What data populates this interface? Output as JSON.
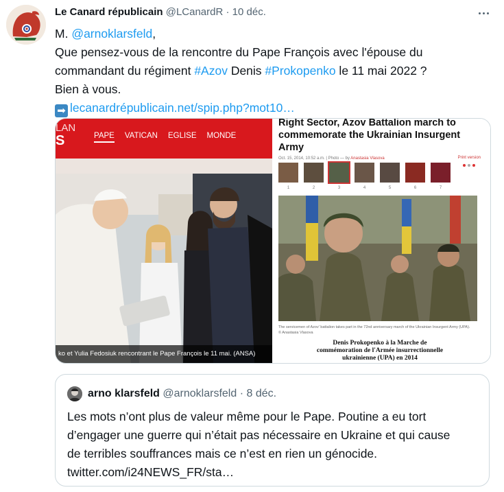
{
  "tweet": {
    "author_name": "Le Canard républicain",
    "handle": "@LCanardR",
    "separator": "·",
    "date": "10 déc.",
    "lines": {
      "l1_prefix": "M. ",
      "l1_mention": "@arnoklarsfeld",
      "l1_suffix": ",",
      "l2": "Que pensez-vous de la rencontre du Pape François avec l'épouse du",
      "l3_a": "commandant du régiment ",
      "l3_tag1": "#Azov",
      "l3_b": " Denis ",
      "l3_tag2": "#Prokopenko",
      "l3_c": " le 11 mai 2022 ?",
      "l4": "Bien à vous.",
      "link": "lecanardrépublicain.net/spip.php?mot10…"
    },
    "arrow_icon": "➡"
  },
  "media": {
    "left": {
      "logo_line1": "LAN",
      "logo_line2": "S",
      "nav": [
        "PAPE",
        "VATICAN",
        "EGLISE",
        "MONDE"
      ],
      "caption": "ko et Yulia Fedosiuk rencontrant le Pape François le 11 mai.  (ANSA)"
    },
    "right": {
      "title": "Right Sector, Azov Battalion march to commemorate the Ukrainian Insurgent Army",
      "meta_text": "Oct. 15, 2014, 10:52 a.m. | Photo — by ",
      "meta_author": "Anastasia Vlasova",
      "print": "Print version",
      "thumb_numbers": [
        "1",
        "2",
        "3",
        "4",
        "5",
        "6",
        "7"
      ],
      "photo_credit": "The servicemen of Azov' battalion takes part in the 72nd anniversary march of the Ukrainian Insurgent Army (UPA).\n© Anastasia Vlasova",
      "fr_caption_1": "Denis Prokopenko à la Marche de",
      "fr_caption_2": "commémoration de l'Armée insurrectionnelle",
      "fr_caption_3": "ukrainienne (UPA) en 2014"
    }
  },
  "quoted": {
    "author_name": "arno klarsfeld",
    "handle": "@arnoklarsfeld",
    "separator": "·",
    "date": "8 déc.",
    "line1": "Les mots n’ont plus de valeur même pour le Pape. Poutine a eu tort",
    "line2": "d’engager une guerre qui n’était pas nécessaire en Ukraine et qui cause",
    "line3": "de terribles souffrances mais ce n’est en rien un génocide.",
    "line4": "twitter.com/i24NEWS_FR/sta…"
  },
  "colors": {
    "link": "#1d9bf0",
    "lemonde_red": "#d8181d",
    "muted": "#536471"
  }
}
